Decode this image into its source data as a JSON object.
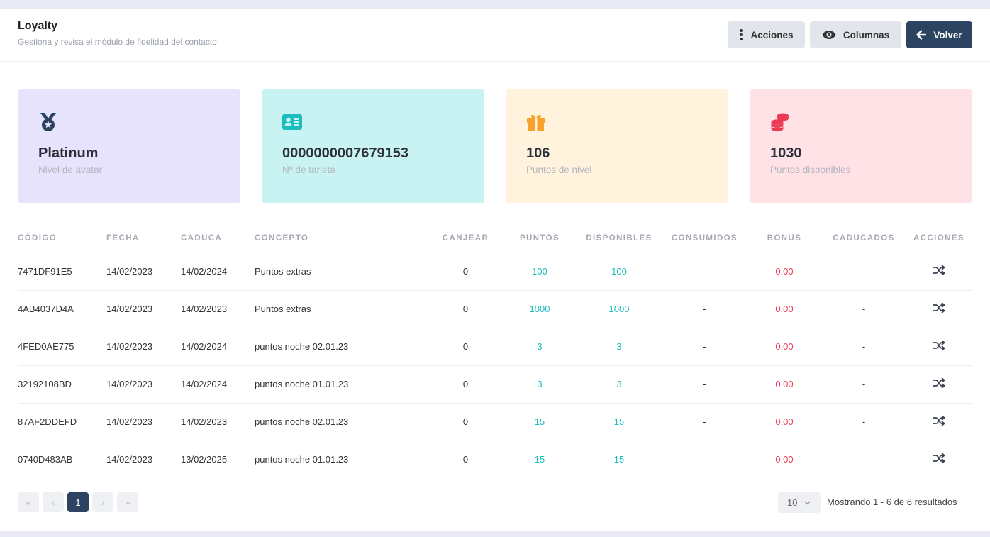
{
  "header": {
    "title": "Loyalty",
    "subtitle": "Gestiona y revisa el módulo de fidelidad del contacto",
    "buttons": {
      "actions": "Acciones",
      "columns": "Columnas",
      "back": "Volver"
    }
  },
  "cards": [
    {
      "value": "Platinum",
      "label": "Nivel de avatar",
      "icon": "medal-star-icon",
      "color": "#e8e3fd"
    },
    {
      "value": "0000000007679153",
      "label": "Nº de tarjeta",
      "icon": "id-card-icon",
      "color": "#c9f3f2"
    },
    {
      "value": "106",
      "label": "Puntos de nivel",
      "icon": "gift-icon",
      "color": "#fff3de"
    },
    {
      "value": "1030",
      "label": "Puntos disponibles",
      "icon": "coins-icon",
      "color": "#fee2e6"
    }
  ],
  "table": {
    "columns": [
      "CÓDIGO",
      "FECHA",
      "CADUCA",
      "CONCEPTO",
      "CANJEAR",
      "PUNTOS",
      "DISPONIBLES",
      "CONSUMIDOS",
      "BONUS",
      "CADUCADOS",
      "ACCIONES"
    ],
    "rows": [
      {
        "codigo": "7471DF91E5",
        "fecha": "14/02/2023",
        "caduca": "14/02/2024",
        "concepto": "Puntos extras",
        "canjear": "0",
        "puntos": "100",
        "disponibles": "100",
        "consumidos": "-",
        "bonus": "0.00",
        "caducados": "-"
      },
      {
        "codigo": "4AB4037D4A",
        "fecha": "14/02/2023",
        "caduca": "14/02/2023",
        "concepto": "Puntos extras",
        "canjear": "0",
        "puntos": "1000",
        "disponibles": "1000",
        "consumidos": "-",
        "bonus": "0.00",
        "caducados": "-"
      },
      {
        "codigo": "4FED0AE775",
        "fecha": "14/02/2023",
        "caduca": "14/02/2024",
        "concepto": "puntos noche 02.01.23",
        "canjear": "0",
        "puntos": "3",
        "disponibles": "3",
        "consumidos": "-",
        "bonus": "0.00",
        "caducados": "-"
      },
      {
        "codigo": "32192108BD",
        "fecha": "14/02/2023",
        "caduca": "14/02/2024",
        "concepto": "puntos noche 01.01.23",
        "canjear": "0",
        "puntos": "3",
        "disponibles": "3",
        "consumidos": "-",
        "bonus": "0.00",
        "caducados": "-"
      },
      {
        "codigo": "87AF2DDEFD",
        "fecha": "14/02/2023",
        "caduca": "14/02/2023",
        "concepto": "puntos noche 02.01.23",
        "canjear": "0",
        "puntos": "15",
        "disponibles": "15",
        "consumidos": "-",
        "bonus": "0.00",
        "caducados": "-"
      },
      {
        "codigo": "0740D483AB",
        "fecha": "14/02/2023",
        "caduca": "13/02/2025",
        "concepto": "puntos noche 01.01.23",
        "canjear": "0",
        "puntos": "15",
        "disponibles": "15",
        "consumidos": "-",
        "bonus": "0.00",
        "caducados": "-"
      }
    ]
  },
  "pagination": {
    "first": "«",
    "prev": "‹",
    "current": "1",
    "next": "›",
    "last": "»",
    "page_size": "10",
    "summary": "Mostrando 1 - 6 de 6 resultados"
  },
  "colors": {
    "accent_dark": "#2c4461",
    "teal": "#1cbdbd",
    "red": "#ee3b55"
  }
}
